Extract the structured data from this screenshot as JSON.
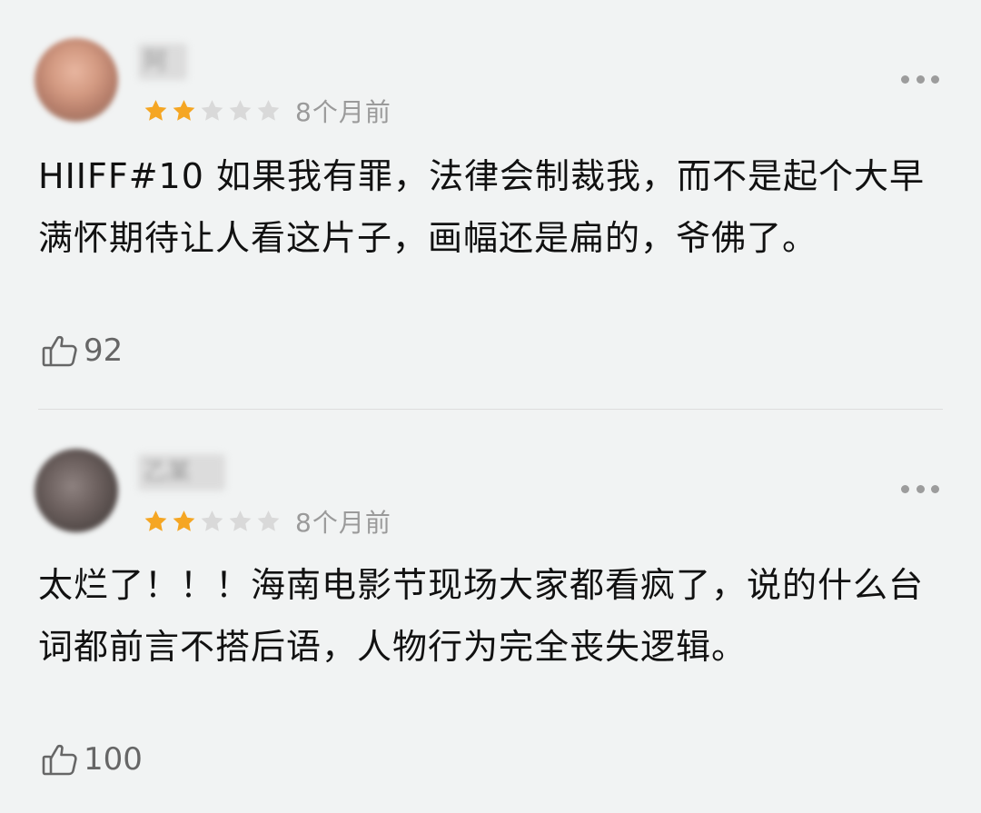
{
  "reviews": [
    {
      "username": "阿",
      "rating": 2,
      "max_rating": 5,
      "time": "8个月前",
      "content": "HIIFF#10 如果我有罪，法律会制裁我，而不是起个大早满怀期待让人看这片子，画幅还是扁的，爷佛了。",
      "likes": "92"
    },
    {
      "username": "乙某",
      "rating": 2,
      "max_rating": 5,
      "time": "8个月前",
      "content": "太烂了！！！海南电影节现场大家都看疯了，说的什么台词都前言不搭后语，人物行为完全丧失逻辑。",
      "likes": "100"
    }
  ],
  "colors": {
    "star_filled": "#f5a623",
    "star_empty": "#d9d9d9",
    "background": "#f1f3f3",
    "muted_text": "#9a9a9a"
  },
  "icons": {
    "more": "more-dots-icon",
    "like": "thumbs-up-icon",
    "star": "star-icon"
  }
}
